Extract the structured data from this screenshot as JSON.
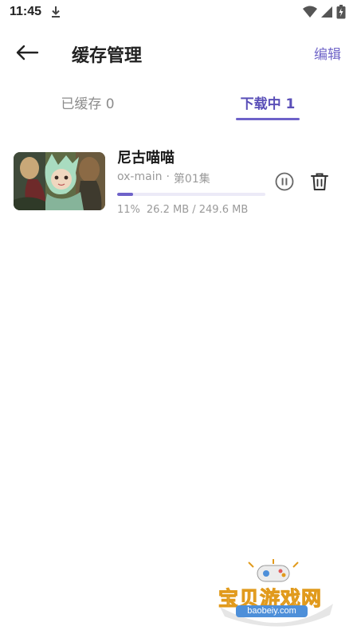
{
  "status_bar": {
    "time": "11:45",
    "icons": [
      "download-icon",
      "wifi-icon",
      "signal-icon",
      "battery-icon"
    ]
  },
  "app_bar": {
    "title": "缓存管理",
    "edit_label": "编辑",
    "back_icon": "arrow-left-icon"
  },
  "tabs": [
    {
      "label": "已缓存 0",
      "active": false
    },
    {
      "label": "下载中 1",
      "active": true
    }
  ],
  "download_item": {
    "title": "尼古喵喵",
    "source": "ox-main",
    "separator": "·",
    "episode": "第01集",
    "progress_percent": 11,
    "progress_label": "11%",
    "size_label": "26.2 MB / 249.6 MB",
    "pause_icon": "pause-circle-icon",
    "delete_icon": "trash-icon"
  },
  "watermark": {
    "text": "宝贝游戏网",
    "url": "baobeiy.com"
  },
  "colors": {
    "accent": "#6e62c9",
    "tab_active": "#5a4fb8",
    "muted_text": "#9a9a9a"
  }
}
